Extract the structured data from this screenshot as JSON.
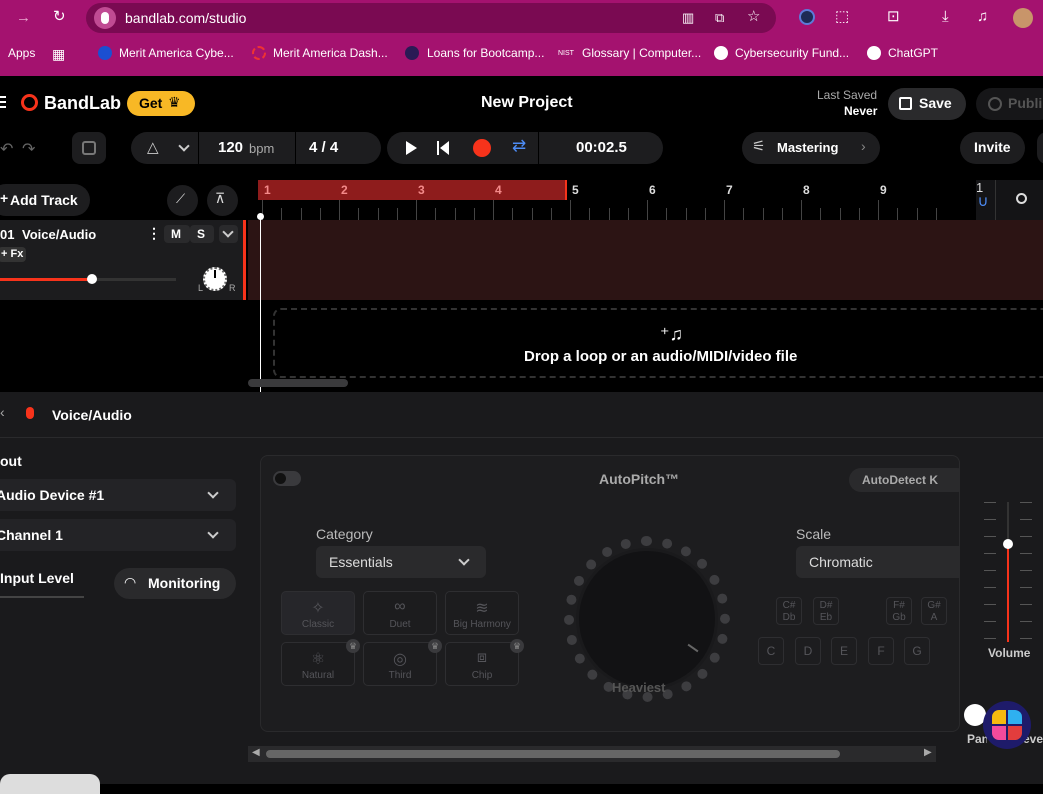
{
  "browser": {
    "url": "bandlab.com/studio",
    "bookmarks": [
      {
        "label": "Apps"
      },
      {
        "label": "Merit America Cybe..."
      },
      {
        "label": "Merit America Dash..."
      },
      {
        "label": "Loans for Bootcamp..."
      },
      {
        "label": "Glossary | Computer..."
      },
      {
        "label": "Cybersecurity Fund..."
      },
      {
        "label": "ChatGPT"
      }
    ],
    "nist_label": "NIST"
  },
  "header": {
    "brand": "BandLab",
    "get_label": "Get",
    "project_title": "New Project",
    "last_saved_label": "Last Saved",
    "last_saved_value": "Never",
    "save_label": "Save",
    "publish_label": "Publi"
  },
  "transport": {
    "bpm_value": "120",
    "bpm_unit": "bpm",
    "time_sig": "4 / 4",
    "time": "00:02.5",
    "mastering_label": "Mastering",
    "invite_label": "Invite"
  },
  "tracks": {
    "add_track_label": "Add Track",
    "items": [
      {
        "number": "01",
        "name": "Voice/Audio",
        "mute": "M",
        "solo": "S",
        "fx_label": "+ Fx",
        "pan_l": "L",
        "pan_r": "R",
        "volume_level": 0.52
      }
    ],
    "drop_hint": "Drop a loop or an audio/MIDI/video file"
  },
  "ruler": {
    "bars": [
      "1",
      "2",
      "3",
      "4",
      "5",
      "6",
      "7",
      "8",
      "9",
      "1"
    ]
  },
  "panel": {
    "title": "Voice/Audio",
    "input_heading": "out",
    "device": "Audio Device #1",
    "channel": "Channel 1",
    "input_level_label": "Input Level",
    "monitoring_label": "Monitoring",
    "autopitch": {
      "title": "AutoPitch™",
      "autodetect_label": "AutoDetect K",
      "category_label": "Category",
      "category_value": "Essentials",
      "scale_label": "Scale",
      "scale_value": "Chromatic",
      "knob_label": "Heaviest",
      "presets": [
        {
          "label": "Classic",
          "icon": "sparkle-icon"
        },
        {
          "label": "Duet",
          "icon": "glasses-icon"
        },
        {
          "label": "Big Harmony",
          "icon": "waves-icon"
        },
        {
          "label": "Natural",
          "icon": "atom-icon"
        },
        {
          "label": "Third",
          "icon": "aperture-icon"
        },
        {
          "label": "Chip",
          "icon": "puzzle-icon"
        }
      ],
      "sharp_keys": [
        {
          "top": "C#",
          "bottom": "Db"
        },
        {
          "top": "D#",
          "bottom": "Eb"
        },
        {
          "top": "F#",
          "bottom": "Gb"
        },
        {
          "top": "G#",
          "bottom": "A"
        }
      ],
      "natural_keys": [
        "C",
        "D",
        "E",
        "F",
        "G"
      ]
    },
    "volume_label": "Volume",
    "pan_label": "Pan",
    "level_label": "Leve",
    "volume_level": 0.7
  },
  "colors": {
    "accent": "#f7331b",
    "chrome": "#a4126f",
    "get_button": "#f8b825",
    "region": "#3a1414"
  }
}
